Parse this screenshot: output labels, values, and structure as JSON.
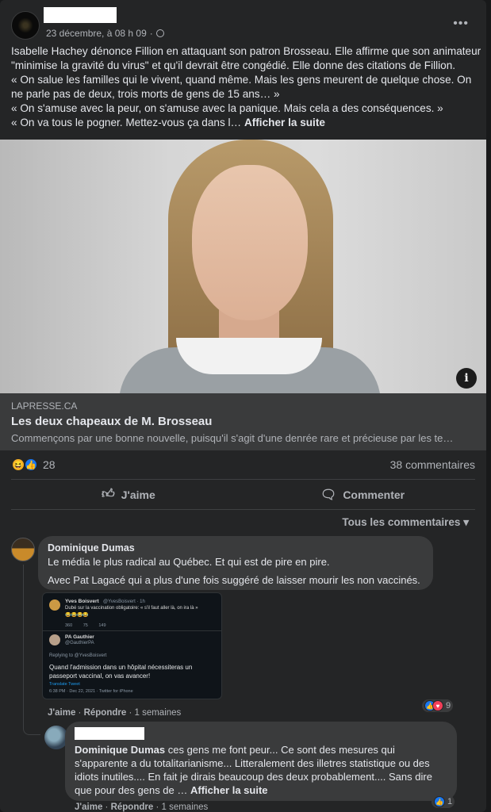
{
  "post": {
    "date": "23 décembre, à 08 h 09",
    "dot": "·",
    "more_label": "•••",
    "text_lines": [
      "Isabelle Hachey dénonce Fillion en attaquant son patron Brosseau. Elle affirme que son animateur",
      "\"minimise la gravité du virus\" et qu'il devrait être congédié. Elle donne des citations de Fillion.",
      " « On salue les familles qui le vivent, quand même. Mais les gens meurent de quelque chose. On",
      "ne parle pas de deux, trois morts de gens de 15 ans… »",
      "« On s'amuse avec la peur, on s'amuse avec la panique. Mais cela a des conséquences. »",
      " « On va tous le pogner. Mettez-vous ça dans l…"
    ],
    "see_more": "Afficher la suite"
  },
  "link": {
    "domain": "LAPRESSE.CA",
    "title": "Les deux chapeaux de M. Brosseau",
    "description": "Commençons par une bonne nouvelle, puisqu'il s'agit d'une denrée rare et précieuse par les te…",
    "info_label": "i"
  },
  "stats": {
    "reaction_count": "28",
    "comments": "38 commentaires"
  },
  "actions": {
    "like": "J'aime",
    "comment": "Commenter",
    "filter": "Tous les commentaires"
  },
  "comments": [
    {
      "author": "Dominique Dumas",
      "lines": [
        "Le média le plus radical au Québec. Et qui est de pire en pire.",
        "Avec Pat Lagacé qui a plus d'une fois suggéré de laisser mourir les non vaccinés."
      ],
      "like": "J'aime",
      "reply": "Répondre",
      "time": "1 semaines",
      "reaction_count": "9",
      "embed": {
        "tweet1_name": "Yves Boisvert",
        "tweet1_handle": "@YvesBoisvert · 1h",
        "tweet1_text": "Dubé sur la vaccination obligatoire: « s'il faut aller là, on ira là »",
        "tweet1_stats": "360 75 149",
        "tweet2_name": "PA Gauthier",
        "tweet2_handle": "@GauthierPA",
        "replying": "Replying to @YvesBoisvert",
        "tweet2_text": "Quand l'admission dans un hôpital nécessiteras un passeport vaccinal, on vas avancer!",
        "translate": "Translate Tweet",
        "footer": "6:38 PM · Dec 22, 2021 · Twitter for iPhone"
      }
    },
    {
      "mention": "Dominique Dumas",
      "lines": [
        " ces gens me font peur... Ce sont des mesures qui",
        "s'apparente a du totalitarianisme... Litteralement des illetres statistique ou des",
        "idiots inutiles.... En fait je dirais beaucoup des deux probablement.... Sans dire",
        "que pour des gens de … "
      ],
      "see_more": "Afficher la suite",
      "like": "J'aime",
      "reply": "Répondre",
      "time": "1 semaines",
      "reaction_count": "1"
    }
  ],
  "colors": {
    "background": "#18191a",
    "card": "#242526",
    "bubble": "#3a3b3c",
    "like_blue": "#1877f2",
    "text": "#e4e6eb",
    "muted": "#b0b3b8"
  }
}
